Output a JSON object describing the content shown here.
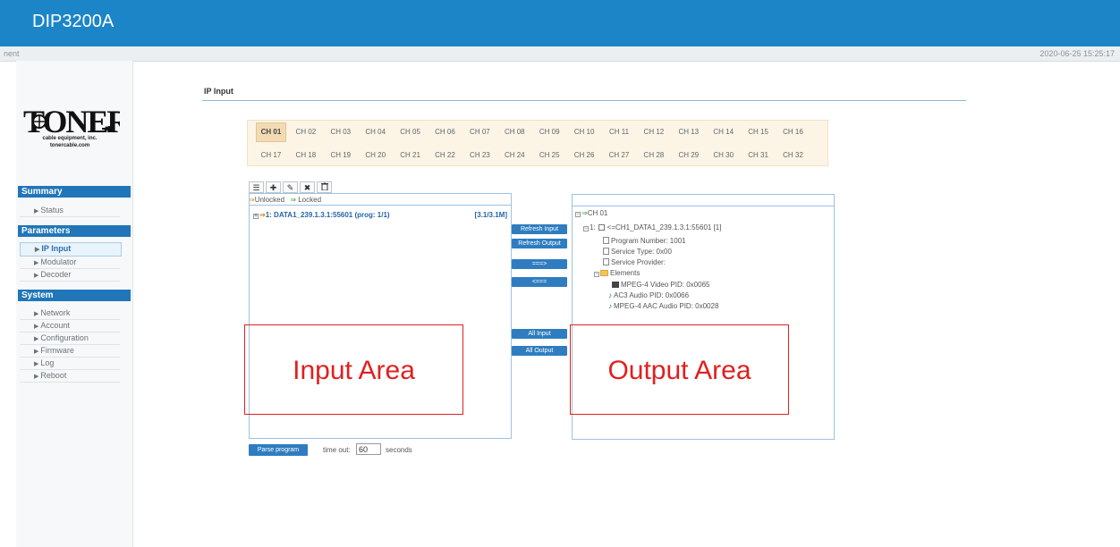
{
  "app": {
    "title": "DIP3200A",
    "subbar_left": "nent",
    "datetime": "2020-06-25 15:25:17"
  },
  "logo": {
    "brand": "TONER",
    "tagline": "cable equipment, inc.",
    "url": "tonercable.com"
  },
  "sidebar": {
    "summary": {
      "label": "Summary",
      "items": [
        {
          "label": "Status"
        }
      ]
    },
    "parameters": {
      "label": "Parameters",
      "items": [
        {
          "label": "IP Input",
          "active": true
        },
        {
          "label": "Modulator"
        },
        {
          "label": "Decoder"
        }
      ]
    },
    "system": {
      "label": "System",
      "items": [
        {
          "label": "Network"
        },
        {
          "label": "Account"
        },
        {
          "label": "Configuration"
        },
        {
          "label": "Firmware"
        },
        {
          "label": "Log"
        },
        {
          "label": "Reboot"
        }
      ]
    }
  },
  "page": {
    "title": "IP Input"
  },
  "channels": {
    "row1": [
      "CH 01",
      "CH 02",
      "CH 03",
      "CH 04",
      "CH 05",
      "CH 06",
      "CH 07",
      "CH 08",
      "CH 09",
      "CH 10",
      "CH 11",
      "CH 12",
      "CH 13",
      "CH 14",
      "CH 15",
      "CH 16"
    ],
    "row2": [
      "CH 17",
      "CH 18",
      "CH 19",
      "CH 20",
      "CH 21",
      "CH 22",
      "CH 23",
      "CH 24",
      "CH 25",
      "CH 26",
      "CH 27",
      "CH 28",
      "CH 29",
      "CH 30",
      "CH 31",
      "CH 32"
    ],
    "selected": "CH 01"
  },
  "toolbar": {
    "icons": [
      "list-icon",
      "plus-icon",
      "edit-icon",
      "close-icon",
      "trash-icon"
    ],
    "glyphs": [
      "☰",
      "✚",
      "✎",
      "✖",
      "🗑"
    ]
  },
  "legend": {
    "unlocked": "Unlocked",
    "locked": "Locked"
  },
  "input_panel": {
    "entry": "1: DATA1_239.1.3.1:55601 (prog: 1/1)",
    "rate": "[3.1/3.1M]"
  },
  "buttons": {
    "refresh_input": "Refresh Input",
    "refresh_output": "Refresh Output",
    "add": "===>",
    "remove": "<===",
    "all_input": "All Input",
    "all_output": "All Output",
    "parse": "Parse program"
  },
  "output_panel": {
    "channel": "CH 01",
    "program": "1: ☐ <=CH1_DATA1_239.1.3.1:55601 [1]",
    "program_prefix": "1:",
    "program_text": "<=CH1_DATA1_239.1.3.1:55601 [1]",
    "program_number": "Program Number: 1001",
    "service_type": "Service Type: 0x00",
    "service_provider": "Service Provider:",
    "elements_label": "Elements",
    "elements": [
      "MPEG-4 Video PID: 0x0065",
      "AC3 Audio PID: 0x0066",
      "MPEG-4 AAC Audio PID: 0x0028"
    ]
  },
  "annotations": {
    "input": "Input Area",
    "output": "Output Area"
  },
  "timeout": {
    "label": "time out:",
    "value": "60",
    "unit": "seconds"
  }
}
